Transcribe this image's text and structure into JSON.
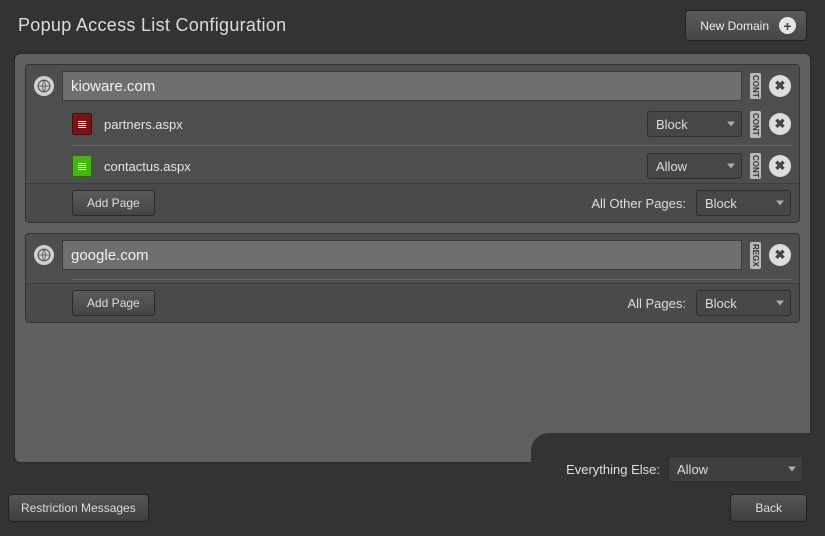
{
  "header": {
    "title": "Popup Access List Configuration",
    "new_domain_label": "New Domain"
  },
  "domains": [
    {
      "name": "kioware.com",
      "badge": "CONT",
      "pages": [
        {
          "name": "partners.aspx",
          "action": "Block",
          "badge": "CONT",
          "color": "red"
        },
        {
          "name": "contactus.aspx",
          "action": "Allow",
          "badge": "CONT",
          "color": "green"
        }
      ],
      "footer_label": "All Other Pages:",
      "footer_action": "Block",
      "add_page_label": "Add Page"
    },
    {
      "name": "google.com",
      "badge": "REGX",
      "pages": [],
      "footer_label": "All Pages:",
      "footer_action": "Block",
      "add_page_label": "Add Page"
    }
  ],
  "everything_else": {
    "label": "Everything Else:",
    "value": "Allow"
  },
  "bottom": {
    "restriction_label": "Restriction Messages",
    "back_label": "Back"
  },
  "icons": {
    "page_glyph": "≣"
  }
}
